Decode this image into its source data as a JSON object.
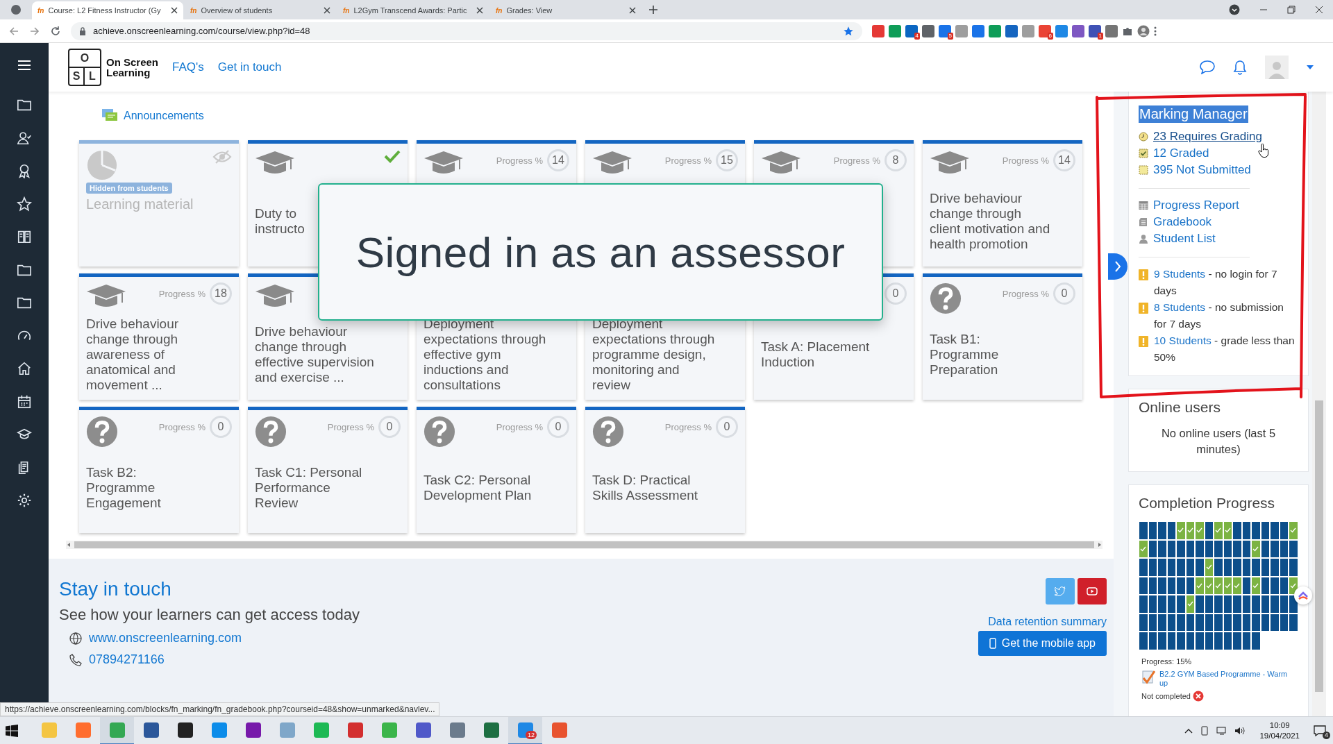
{
  "browser": {
    "tabs": [
      {
        "icon_text": "fn",
        "title": "Course: L2 Fitness Instructor (Gy",
        "selected": true
      },
      {
        "icon_text": "fn",
        "title": "Overview of students",
        "selected": false
      },
      {
        "icon_text": "fn",
        "title": "L2Gym Transcend Awards: Partic",
        "selected": false
      },
      {
        "icon_text": "fn",
        "title": "Grades: View",
        "selected": false
      }
    ],
    "url": "achieve.onscreenlearning.com/course/view.php?id=48",
    "extensions": [
      {
        "color": "#e53935"
      },
      {
        "color": "#0f9d58"
      },
      {
        "color": "#0a66c2",
        "badge": "4"
      },
      {
        "color": "#5f6368"
      },
      {
        "color": "#1a73e8",
        "badge": "5"
      },
      {
        "color": "#9e9e9e"
      },
      {
        "color": "#1a73e8"
      },
      {
        "color": "#0f9d58"
      },
      {
        "color": "#1565c0"
      },
      {
        "color": "#9e9e9e"
      },
      {
        "color": "#ea4335",
        "badge": "6"
      },
      {
        "color": "#1e88e5"
      },
      {
        "color": "#7e57c2"
      },
      {
        "color": "#3f51b5",
        "badge": "1"
      },
      {
        "color": "#757575"
      }
    ]
  },
  "header": {
    "logo_letters": [
      "O",
      "S",
      "L"
    ],
    "brand": [
      "On Screen",
      "Learning"
    ],
    "links": [
      "FAQ's",
      "Get in touch"
    ]
  },
  "announcements": "Announcements",
  "cards": [
    {
      "kind": "hidden",
      "badge": "Hidden from students",
      "lines": [
        "Learning material"
      ]
    },
    {
      "kind": "course",
      "completed": true,
      "lines": [
        "Duty to",
        "instructo"
      ]
    },
    {
      "kind": "course",
      "progress_label": "Progress %",
      "progress": "14"
    },
    {
      "kind": "course",
      "progress_label": "Progress %",
      "progress": "15"
    },
    {
      "kind": "course",
      "progress_label": "Progress %",
      "progress": "8"
    },
    {
      "kind": "course",
      "progress_label": "Progress %",
      "progress": "14",
      "lines": [
        "Drive behaviour",
        "change through",
        "client motivation and",
        "health promotion"
      ]
    },
    {
      "kind": "course",
      "progress_label": "Progress %",
      "progress": "18",
      "lines": [
        "Drive behaviour",
        "change through",
        "awareness of",
        "anatomical and",
        "movement ..."
      ]
    },
    {
      "kind": "course",
      "lines": [
        "Drive behaviour",
        "change through",
        "effective supervision",
        "and exercise ..."
      ]
    },
    {
      "kind": "covered",
      "lines": [
        "Deployment",
        "expectations through",
        "effective gym",
        "inductions and",
        "consultations"
      ]
    },
    {
      "kind": "covered",
      "lines": [
        "Deployment",
        "expectations through",
        "programme design,",
        "monitoring and",
        "review"
      ]
    },
    {
      "kind": "covered",
      "progress": "0",
      "lines": [
        "Task A: Placement",
        "Induction"
      ]
    },
    {
      "kind": "task",
      "progress_label": "Progress %",
      "progress": "0",
      "lines": [
        "Task B1:",
        "Programme",
        "Preparation"
      ]
    },
    {
      "kind": "task",
      "progress_label": "Progress %",
      "progress": "0",
      "lines": [
        "Task B2:",
        "Programme",
        "Engagement"
      ]
    },
    {
      "kind": "task",
      "progress_label": "Progress %",
      "progress": "0",
      "lines": [
        "Task C1: Personal",
        "Performance",
        "Review"
      ]
    },
    {
      "kind": "task",
      "progress_label": "Progress %",
      "progress": "0",
      "lines": [
        "Task C2: Personal",
        "Development Plan"
      ]
    },
    {
      "kind": "task",
      "progress_label": "Progress %",
      "progress": "0",
      "lines": [
        "Task D: Practical",
        "Skills Assessment"
      ]
    }
  ],
  "overlay": {
    "text": "Signed in as an assessor"
  },
  "footer": {
    "title": "Stay in touch",
    "subtitle": "See how your learners can get access today",
    "website": "www.onscreenlearning.com",
    "phone": "07894271166",
    "data_retention": "Data retention summary",
    "app_button": "Get the mobile app"
  },
  "marking_manager": {
    "title": "Marking Manager",
    "highlighted": true,
    "counts": [
      {
        "kind": "requires",
        "label": "23 Requires Grading",
        "hovered": true
      },
      {
        "kind": "graded",
        "label": "12 Graded",
        "hovered": false
      },
      {
        "kind": "not_submitted",
        "label": "395 Not Submitted",
        "hovered": false
      }
    ],
    "reports": [
      {
        "kind": "progress",
        "label": "Progress Report"
      },
      {
        "kind": "gradebook",
        "label": "Gradebook"
      },
      {
        "kind": "students",
        "label": "Student List"
      }
    ],
    "alerts": [
      {
        "link": "9 Students",
        "text": " - no login for 7 days"
      },
      {
        "link": "8 Students",
        "text": " - no submission for 7 days"
      },
      {
        "link": "10 Students",
        "text": " - grade less than 50%"
      }
    ]
  },
  "online_users": {
    "title": "Online users",
    "text": "No online users (last 5 minutes)"
  },
  "completion": {
    "title": "Completion Progress",
    "grid": [
      [
        false,
        false,
        false,
        false,
        true,
        true,
        true,
        false,
        true,
        true,
        false,
        false,
        false,
        false,
        false,
        false,
        true
      ],
      [
        true,
        false,
        false,
        false,
        false,
        false,
        false,
        false,
        false,
        false,
        false,
        false,
        true,
        false,
        false,
        false,
        false
      ],
      [
        false,
        false,
        false,
        false,
        false,
        false,
        false,
        true,
        false,
        false,
        false,
        false,
        false,
        false,
        false,
        false,
        false
      ],
      [
        false,
        false,
        false,
        false,
        false,
        false,
        true,
        true,
        true,
        true,
        true,
        false,
        true,
        false,
        false,
        false,
        true
      ],
      [
        false,
        false,
        false,
        false,
        false,
        true,
        false,
        false,
        false,
        false,
        false,
        false,
        false,
        false,
        false,
        false,
        false
      ],
      [
        false,
        false,
        false,
        false,
        false,
        false,
        false,
        false,
        false,
        false,
        false,
        false,
        false,
        false,
        false,
        false,
        false
      ],
      [
        false,
        false,
        false,
        false,
        false,
        false,
        false,
        false,
        false,
        false,
        false,
        false,
        false
      ]
    ],
    "progress": "Progress: 15%",
    "activity": "B2.2 GYM Based Programme - Warm up",
    "status": "Not completed"
  },
  "status_url": "https://achieve.onscreenlearning.com/blocks/fn_marking/fn_gradebook.php?courseid=48&show=unmarked&navlev...",
  "taskbar": {
    "apps": [
      {
        "color": "#f4c542",
        "selected": false
      },
      {
        "color": "#ff6d2e",
        "selected": false
      },
      {
        "color": "#34a853",
        "selected": true
      },
      {
        "color": "#2b579a",
        "selected": false
      },
      {
        "color": "#222222",
        "selected": false
      },
      {
        "color": "#0c8ce9",
        "selected": false
      },
      {
        "color": "#7719aa",
        "selected": false
      },
      {
        "color": "#7fa7c9",
        "selected": false
      },
      {
        "color": "#1db954",
        "selected": false
      },
      {
        "color": "#d32f2f",
        "selected": false
      },
      {
        "color": "#3bb54a",
        "selected": false
      },
      {
        "color": "#5059c9",
        "selected": false
      },
      {
        "color": "#6b7b8c",
        "selected": false
      },
      {
        "color": "#1d6f42",
        "selected": false
      },
      {
        "color": "#1e88e5",
        "selected": true,
        "badge": "12"
      },
      {
        "color": "#e8532f",
        "selected": false
      }
    ],
    "time": "10:09",
    "date": "19/04/2021",
    "notifications": "4"
  }
}
